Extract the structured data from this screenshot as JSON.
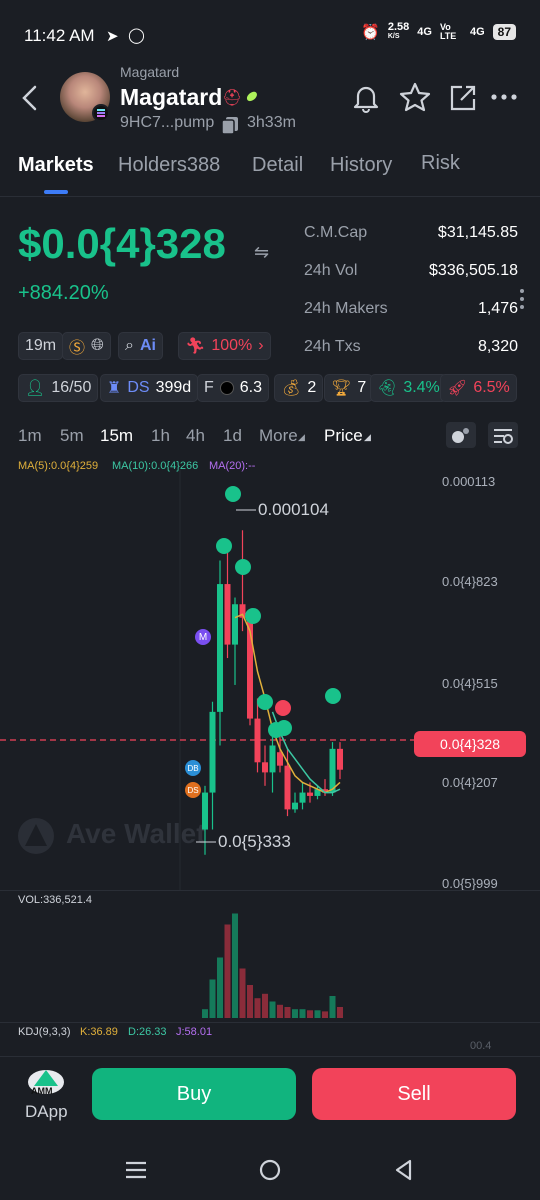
{
  "status": {
    "time": "11:42 AM",
    "net_speed": "2.58",
    "net_unit": "K/S",
    "sig1": "4G",
    "volte": "Vo LTE",
    "sig2": "4G",
    "battery": "87"
  },
  "token": {
    "sub_name": "Magatard",
    "name": "Magatard",
    "address": "9HC7...pump",
    "age": "3h33m"
  },
  "tabs": [
    "Markets",
    "Holders388",
    "Detail",
    "History",
    "Risk"
  ],
  "price": {
    "value": "$0.0{4}328",
    "change": "+884.20%"
  },
  "stats": [
    {
      "k": "C.M.Cap",
      "v": "$31,145.85"
    },
    {
      "k": "24h Vol",
      "v": "$336,505.18"
    },
    {
      "k": "24h Makers",
      "v": "1,476"
    },
    {
      "k": "24h Txs",
      "v": "8,320"
    }
  ],
  "chips": {
    "age": "19m",
    "percent": "100%",
    "holders": "16/50",
    "ds_label": "DS",
    "ds_value": "399d",
    "f_label": "F",
    "f_value": "6.3",
    "bag": "2",
    "trophy": "7",
    "ghost": "3.4%",
    "rocket": "6.5%"
  },
  "timeframes": [
    "1m",
    "5m",
    "15m",
    "1h",
    "4h",
    "1d",
    "More",
    "Price"
  ],
  "ma_legend": {
    "ma5": "MA(5):0.0{4}259",
    "ma10": "MA(10):0.0{4}266",
    "ma20": "MA(20):--"
  },
  "y_labels": [
    "0.000113",
    "0.0{4}823",
    "0.0{4}515",
    "0.0{4}207",
    "0.0{5}999"
  ],
  "annotations": {
    "high": "0.000104",
    "low": "0.0{5}333",
    "current": "0.0{4}328",
    "m": "M",
    "db": "DB",
    "ds": "DS"
  },
  "watermark": "Ave Wallet",
  "vol_label": "VOL:336,521.4",
  "kdj": {
    "label": "KDJ(9,3,3)",
    "k": "K:36.89",
    "d": "D:26.33",
    "j": "J:58.01",
    "right": "00.4"
  },
  "bottom": {
    "dapp": "DApp",
    "amm": "AMM",
    "buy": "Buy",
    "sell": "Sell"
  },
  "colors": {
    "up": "#19c28b",
    "down": "#f2435a",
    "accent": "#3d7cf7",
    "bg": "#1b1e24"
  },
  "chart_data": {
    "type": "candlestick",
    "interval": "15m",
    "candles": [
      {
        "o": 1.5,
        "h": 2.8,
        "l": 0.75,
        "c": 2.6
      },
      {
        "o": 2.6,
        "h": 5.3,
        "l": 1.5,
        "c": 5.0
      },
      {
        "o": 5.0,
        "h": 9.5,
        "l": 4.0,
        "c": 8.8
      },
      {
        "o": 8.8,
        "h": 9.9,
        "l": 6.6,
        "c": 7.0
      },
      {
        "o": 7.0,
        "h": 8.4,
        "l": 5.8,
        "c": 8.2
      },
      {
        "o": 8.2,
        "h": 10.4,
        "l": 7.4,
        "c": 7.8
      },
      {
        "o": 7.8,
        "h": 8.0,
        "l": 4.6,
        "c": 4.8
      },
      {
        "o": 4.8,
        "h": 5.4,
        "l": 3.2,
        "c": 3.5
      },
      {
        "o": 3.5,
        "h": 4.0,
        "l": 2.8,
        "c": 3.2
      },
      {
        "o": 3.2,
        "h": 4.4,
        "l": 2.6,
        "c": 4.0
      },
      {
        "o": 3.8,
        "h": 4.6,
        "l": 3.2,
        "c": 3.4
      },
      {
        "o": 3.4,
        "h": 3.9,
        "l": 1.9,
        "c": 2.1
      },
      {
        "o": 2.1,
        "h": 2.6,
        "l": 2.0,
        "c": 2.3
      },
      {
        "o": 2.3,
        "h": 2.9,
        "l": 2.1,
        "c": 2.6
      },
      {
        "o": 2.6,
        "h": 2.9,
        "l": 2.3,
        "c": 2.5
      },
      {
        "o": 2.5,
        "h": 2.8,
        "l": 2.4,
        "c": 2.7
      },
      {
        "o": 2.7,
        "h": 3.0,
        "l": 2.5,
        "c": 2.6
      },
      {
        "o": 2.6,
        "h": 4.1,
        "l": 2.5,
        "c": 3.9
      },
      {
        "o": 3.9,
        "h": 4.1,
        "l": 3.0,
        "c": 3.28
      }
    ],
    "volume": [
      0.08,
      0.35,
      0.55,
      0.85,
      0.95,
      0.45,
      0.3,
      0.18,
      0.22,
      0.15,
      0.12,
      0.1,
      0.08,
      0.08,
      0.07,
      0.07,
      0.06,
      0.2,
      0.1
    ],
    "ma_line": [
      null,
      null,
      null,
      null,
      7.8,
      7.9,
      7.4,
      6.2,
      5.4,
      4.5,
      3.9,
      3.5,
      3.1,
      2.9,
      2.8,
      2.7,
      2.6,
      2.7,
      2.9
    ],
    "ma_line2": [
      null,
      null,
      null,
      null,
      null,
      null,
      null,
      null,
      null,
      5.0,
      4.4,
      3.9,
      3.6,
      3.3,
      3.0,
      2.8,
      2.6,
      2.6,
      2.7
    ]
  }
}
